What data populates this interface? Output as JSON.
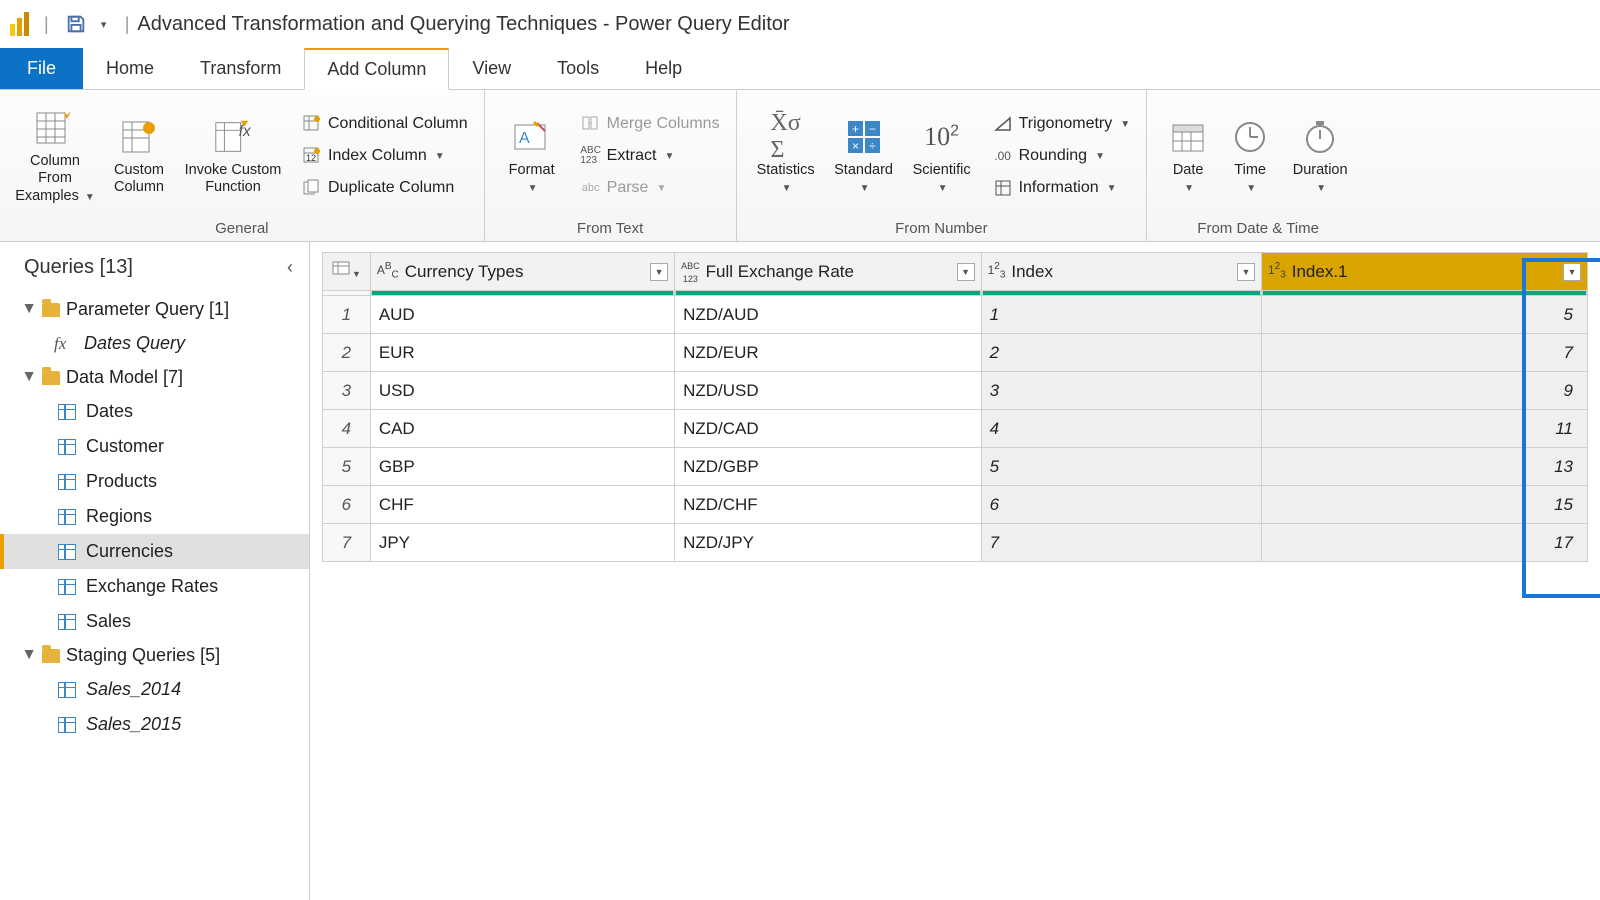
{
  "app": {
    "title": "Advanced Transformation and Querying Techniques - Power Query Editor"
  },
  "tabs": {
    "file": "File",
    "home": "Home",
    "transform": "Transform",
    "add_column": "Add Column",
    "view": "View",
    "tools": "Tools",
    "help": "Help"
  },
  "ribbon": {
    "column_from_examples": "Column From Examples",
    "custom_column": "Custom Column",
    "invoke_custom_function": "Invoke Custom Function",
    "conditional_column": "Conditional Column",
    "index_column": "Index Column",
    "duplicate_column": "Duplicate Column",
    "format": "Format",
    "merge_columns": "Merge Columns",
    "extract": "Extract",
    "parse": "Parse",
    "statistics": "Statistics",
    "standard": "Standard",
    "scientific": "Scientific",
    "trigonometry": "Trigonometry",
    "rounding": "Rounding",
    "information": "Information",
    "date": "Date",
    "time": "Time",
    "duration": "Duration",
    "group_general": "General",
    "group_from_text": "From Text",
    "group_from_number": "From Number",
    "group_from_datetime": "From Date & Time"
  },
  "queries": {
    "title": "Queries [13]",
    "groups": [
      {
        "name": "Parameter Query [1]",
        "items": [
          {
            "name": "Dates Query",
            "type": "fx"
          }
        ]
      },
      {
        "name": "Data Model [7]",
        "items": [
          {
            "name": "Dates",
            "type": "table"
          },
          {
            "name": "Customer",
            "type": "table"
          },
          {
            "name": "Products",
            "type": "table"
          },
          {
            "name": "Regions",
            "type": "table"
          },
          {
            "name": "Currencies",
            "type": "table",
            "selected": true
          },
          {
            "name": "Exchange Rates",
            "type": "table"
          },
          {
            "name": "Sales",
            "type": "table"
          }
        ]
      },
      {
        "name": "Staging Queries [5]",
        "items": [
          {
            "name": "Sales_2014",
            "type": "table",
            "italic": true
          },
          {
            "name": "Sales_2015",
            "type": "table",
            "italic": true
          }
        ]
      }
    ]
  },
  "grid": {
    "columns": [
      {
        "name": "Currency Types",
        "type": "ABC"
      },
      {
        "name": "Full Exchange Rate",
        "type": "ABC123"
      },
      {
        "name": "Index",
        "type": "123"
      },
      {
        "name": "Index.1",
        "type": "123",
        "selected": true
      }
    ],
    "rows": [
      {
        "n": "1",
        "c0": "AUD",
        "c1": "NZD/AUD",
        "c2": "1",
        "c3": "5"
      },
      {
        "n": "2",
        "c0": "EUR",
        "c1": "NZD/EUR",
        "c2": "2",
        "c3": "7"
      },
      {
        "n": "3",
        "c0": "USD",
        "c1": "NZD/USD",
        "c2": "3",
        "c3": "9"
      },
      {
        "n": "4",
        "c0": "CAD",
        "c1": "NZD/CAD",
        "c2": "4",
        "c3": "11"
      },
      {
        "n": "5",
        "c0": "GBP",
        "c1": "NZD/GBP",
        "c2": "5",
        "c3": "13"
      },
      {
        "n": "6",
        "c0": "CHF",
        "c1": "NZD/CHF",
        "c2": "6",
        "c3": "15"
      },
      {
        "n": "7",
        "c0": "JPY",
        "c1": "NZD/JPY",
        "c2": "7",
        "c3": "17"
      }
    ]
  }
}
